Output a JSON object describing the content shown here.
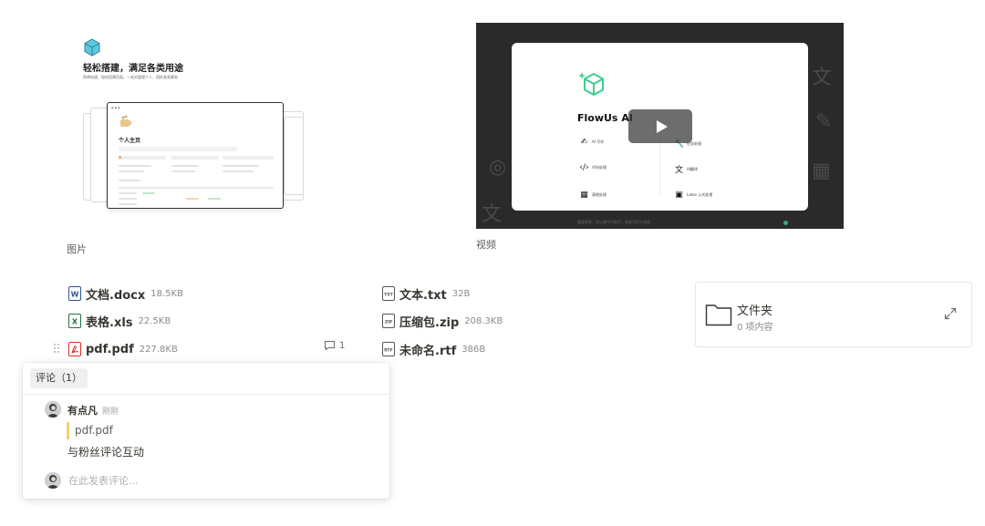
{
  "image_block": {
    "caption": "图片",
    "preview_title": "轻松搭建，满足各类用途",
    "preview_subtitle": "简单快速、轻松搭建页面，一站式管理个人、团队各类事务",
    "preview_page_title": "个人主页"
  },
  "video_block": {
    "caption": "视频",
    "card_title": "FlowUs AI",
    "features": [
      "AI 写作",
      "任务处理",
      "代码处理",
      "AI翻译",
      "表格处理",
      "Latex 公式处理"
    ],
    "footer_text": "重要更新：防止最写作助手，更新可用工具链"
  },
  "files": [
    {
      "name": "文档.docx",
      "size": "18.5KB",
      "type": "docx"
    },
    {
      "name": "表格.xls",
      "size": "22.5KB",
      "type": "xls"
    },
    {
      "name": "pdf.pdf",
      "size": "227.8KB",
      "type": "pdf"
    },
    {
      "name": "文本.txt",
      "size": "32B",
      "type": "txt"
    },
    {
      "name": "压缩包.zip",
      "size": "208.3KB",
      "type": "zip"
    },
    {
      "name": "未命名.rtf",
      "size": "386B",
      "type": "rtf"
    }
  ],
  "comment_badge": {
    "count": "1"
  },
  "folder": {
    "name": "文件夹",
    "count": "0 项内容"
  },
  "comments_panel": {
    "tab_label": "评论（1）",
    "author": "有点凡",
    "time": "刚刚",
    "quote": "pdf.pdf",
    "text": "与粉丝评论互动",
    "input_placeholder": "在此发表评论..."
  },
  "colors": {
    "word_icon": "#2b5797",
    "excel_icon": "#1f7244",
    "pdf_icon": "#d93025",
    "text_primary": "#37352f",
    "text_muted": "#8c8b87",
    "brand_green": "#3ecf8e",
    "quote_bar": "#f1d36a"
  }
}
